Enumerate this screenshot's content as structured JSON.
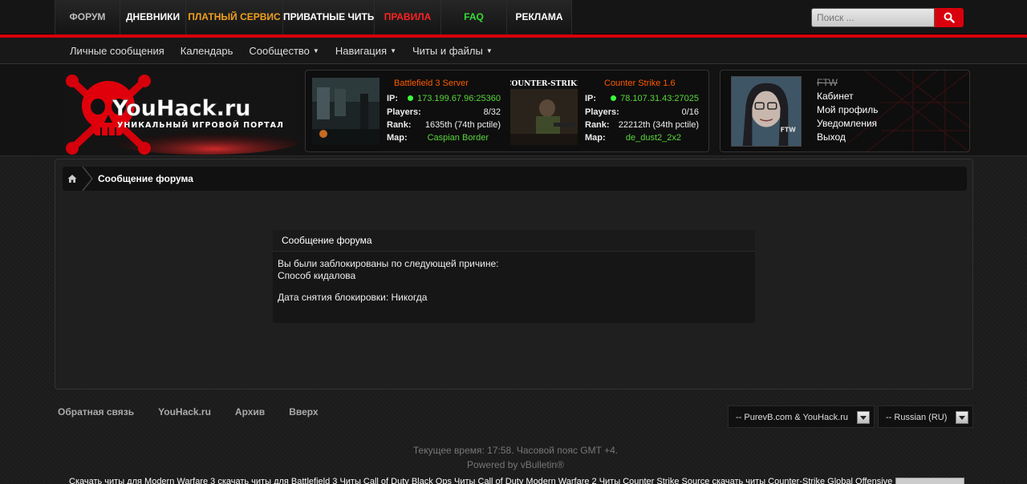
{
  "top_nav": [
    {
      "label": "ФОРУМ",
      "color": "#bbbbbb",
      "width": 81
    },
    {
      "label": "ДНЕВНИКИ",
      "color": "#ffffff",
      "width": 82
    },
    {
      "label": "ПЛАТНЫЙ СЕРВИС",
      "color": "#f0a020",
      "width": 121
    },
    {
      "label": "ПРИВАТНЫЕ ЧИТЫ",
      "color": "#ffffff",
      "width": 114
    },
    {
      "label": "ПРАВИЛА",
      "color": "#ff2222",
      "width": 83
    },
    {
      "label": "FAQ",
      "color": "#33dd33",
      "width": 82
    },
    {
      "label": "РЕКЛАМА",
      "color": "#ffffff",
      "width": 82
    }
  ],
  "search": {
    "placeholder": "Поиск ..."
  },
  "sub_nav": [
    {
      "label": "Личные сообщения",
      "dropdown": false
    },
    {
      "label": "Календарь",
      "dropdown": false
    },
    {
      "label": "Сообщество",
      "dropdown": true
    },
    {
      "label": "Навигация",
      "dropdown": true
    },
    {
      "label": "Читы и файлы",
      "dropdown": true
    }
  ],
  "logo": {
    "text": "YouHack.ru",
    "tagline": "УНИКАЛЬНЫЙ ИГРОВОЙ ПОРТАЛ"
  },
  "servers": [
    {
      "name": "Battlefield 3 Server",
      "ip_label": "IP:",
      "ip": "173.199.67.96:25360",
      "players_label": "Players:",
      "players": "8/32",
      "rank_label": "Rank:",
      "rank": "1635th (74th pctile)",
      "map_label": "Map:",
      "map": "Caspian Border"
    },
    {
      "name": "Counter Strike 1.6",
      "ip_label": "IP:",
      "ip": "78.107.31.43:27025",
      "players_label": "Players:",
      "players": "0/16",
      "rank_label": "Rank:",
      "rank": "22212th (34th pctile)",
      "map_label": "Map:",
      "map": "de_dust2_2x2",
      "thumb_text": "COUNTER-STRIKE"
    }
  ],
  "user": {
    "name": "FTW",
    "avatar_text": "FTW",
    "links": [
      "Кабинет",
      "Мой профиль",
      "Уведомления",
      "Выход"
    ]
  },
  "breadcrumb": {
    "current": "Сообщение форума"
  },
  "message": {
    "title": "Сообщение форума",
    "line1": "Вы были заблокированы по следующей причине:",
    "line2": "Способ кидалова",
    "line3": "Дата снятия блокировки: Никогда"
  },
  "footer": {
    "links": [
      "Обратная связь",
      "YouHack.ru",
      "Архив",
      "Вверх"
    ],
    "style_select": "-- PurevB.com & YouHack.ru",
    "lang_select": "-- Russian (RU)",
    "time": "Текущее время: 17:58. Часовой пояс GMT +4.",
    "powered": "Powered by vBulletin®",
    "seo": "Скачать читы для Modern Warfare 3 скачать читы для Battlefield 3 Читы Call of Duty Black Ops Читы Call of Duty Modern Warfare 2 Читы Counter Strike Source скачать читы Counter-Strike Global Offensive"
  },
  "colors": {
    "accent": "#d4000b",
    "server_name": "#ff5a00",
    "online": "#3cff3c"
  }
}
